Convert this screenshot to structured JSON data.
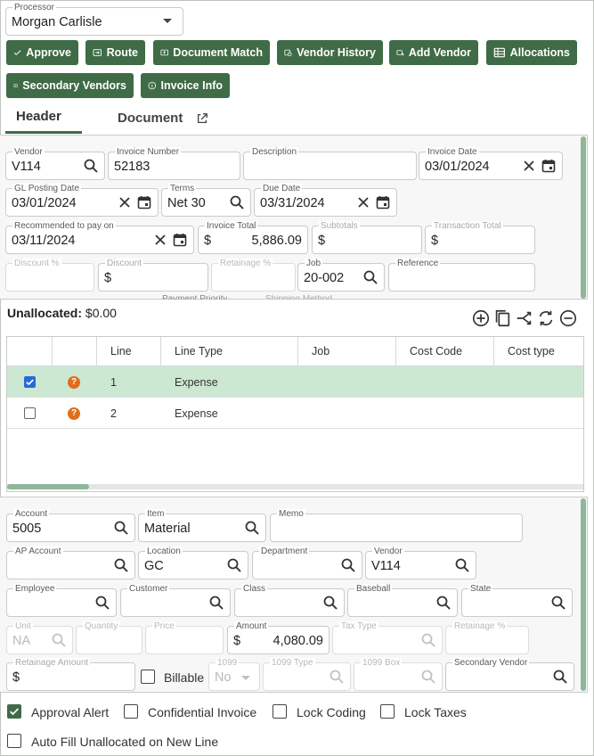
{
  "processor": {
    "label": "Processor",
    "value": "Morgan Carlisle"
  },
  "actions": {
    "approve": "Approve",
    "route": "Route",
    "document_match": "Document Match",
    "vendor_history": "Vendor History",
    "add_vendor": "Add Vendor",
    "allocations": "Allocations",
    "secondary_vendors": "Secondary Vendors",
    "invoice_info": "Invoice Info"
  },
  "tabs": {
    "header": "Header",
    "document": "Document"
  },
  "header_form": {
    "vendor": {
      "label": "Vendor",
      "value": "V114"
    },
    "invoice_number": {
      "label": "Invoice Number",
      "value": "52183"
    },
    "description": {
      "label": "Description",
      "value": ""
    },
    "invoice_date": {
      "label": "Invoice Date",
      "value": "03/01/2024"
    },
    "gl_posting_date": {
      "label": "GL Posting Date",
      "value": "03/01/2024"
    },
    "terms": {
      "label": "Terms",
      "value": "Net 30"
    },
    "due_date": {
      "label": "Due Date",
      "value": "03/31/2024"
    },
    "recommended_pay": {
      "label": "Recommended to pay on",
      "value": "03/11/2024"
    },
    "invoice_total": {
      "label": "Invoice Total",
      "currency": "$",
      "value": "5,886.09"
    },
    "subtotals": {
      "label": "Subtotals",
      "currency": "$",
      "value": ""
    },
    "transaction_total": {
      "label": "Transaction Total",
      "currency": "$",
      "value": ""
    },
    "discount_pct": {
      "label": "Discount %",
      "value": ""
    },
    "discount": {
      "label": "Discount",
      "currency": "$",
      "value": ""
    },
    "retainage_pct": {
      "label": "Retainage %",
      "value": ""
    },
    "job": {
      "label": "Job",
      "value": "20-002"
    },
    "reference": {
      "label": "Reference",
      "value": ""
    },
    "payment_priority": {
      "label": "Payment Priority"
    },
    "shipping_method": {
      "label": "Shipping Method"
    }
  },
  "unallocated": {
    "label": "Unallocated:",
    "value": "$0.00"
  },
  "grid": {
    "columns": [
      "Line",
      "Line Type",
      "Job",
      "Cost Code",
      "Cost type"
    ],
    "rows": [
      {
        "checked": true,
        "status": "?",
        "line": "1",
        "type": "Expense"
      },
      {
        "checked": false,
        "status": "?",
        "line": "2",
        "type": "Expense"
      }
    ]
  },
  "line_form": {
    "account": {
      "label": "Account",
      "value": "5005"
    },
    "item": {
      "label": "Item",
      "value": "Material"
    },
    "memo": {
      "label": "Memo",
      "value": ""
    },
    "ap_account": {
      "label": "AP Account",
      "value": ""
    },
    "location": {
      "label": "Location",
      "value": "GC"
    },
    "department": {
      "label": "Department",
      "value": ""
    },
    "vendor": {
      "label": "Vendor",
      "value": "V114"
    },
    "employee": {
      "label": "Employee",
      "value": ""
    },
    "customer": {
      "label": "Customer",
      "value": ""
    },
    "class": {
      "label": "Class",
      "value": ""
    },
    "baseball": {
      "label": "Baseball",
      "value": ""
    },
    "state": {
      "label": "State",
      "value": ""
    },
    "unit": {
      "label": "Unit",
      "value": "NA"
    },
    "quantity": {
      "label": "Quantity",
      "value": ""
    },
    "price": {
      "label": "Price",
      "value": ""
    },
    "amount": {
      "label": "Amount",
      "currency": "$",
      "value": "4,080.09"
    },
    "tax_type": {
      "label": "Tax Type",
      "value": ""
    },
    "retainage_pct": {
      "label": "Retainage %",
      "value": ""
    },
    "retainage_amount": {
      "label": "Retainage Amount",
      "currency": "$",
      "value": ""
    },
    "billable": {
      "label": "Billable",
      "checked": false
    },
    "f1099": {
      "label": "1099",
      "value": "No"
    },
    "f1099_type": {
      "label": "1099 Type",
      "value": ""
    },
    "f1099_box": {
      "label": "1099 Box",
      "value": ""
    },
    "secondary_vendor": {
      "label": "Secondary Vendor",
      "value": ""
    }
  },
  "options": {
    "approval_alert": {
      "label": "Approval Alert",
      "checked": true
    },
    "confidential_invoice": {
      "label": "Confidential Invoice",
      "checked": false
    },
    "lock_coding": {
      "label": "Lock Coding",
      "checked": false
    },
    "lock_taxes": {
      "label": "Lock Taxes",
      "checked": false
    },
    "auto_fill": {
      "label": "Auto Fill Unallocated on New Line",
      "checked": false
    }
  },
  "colors": {
    "accent": "#3f6b46",
    "row_selected": "#cde8d2",
    "warning": "#e06d1a"
  }
}
